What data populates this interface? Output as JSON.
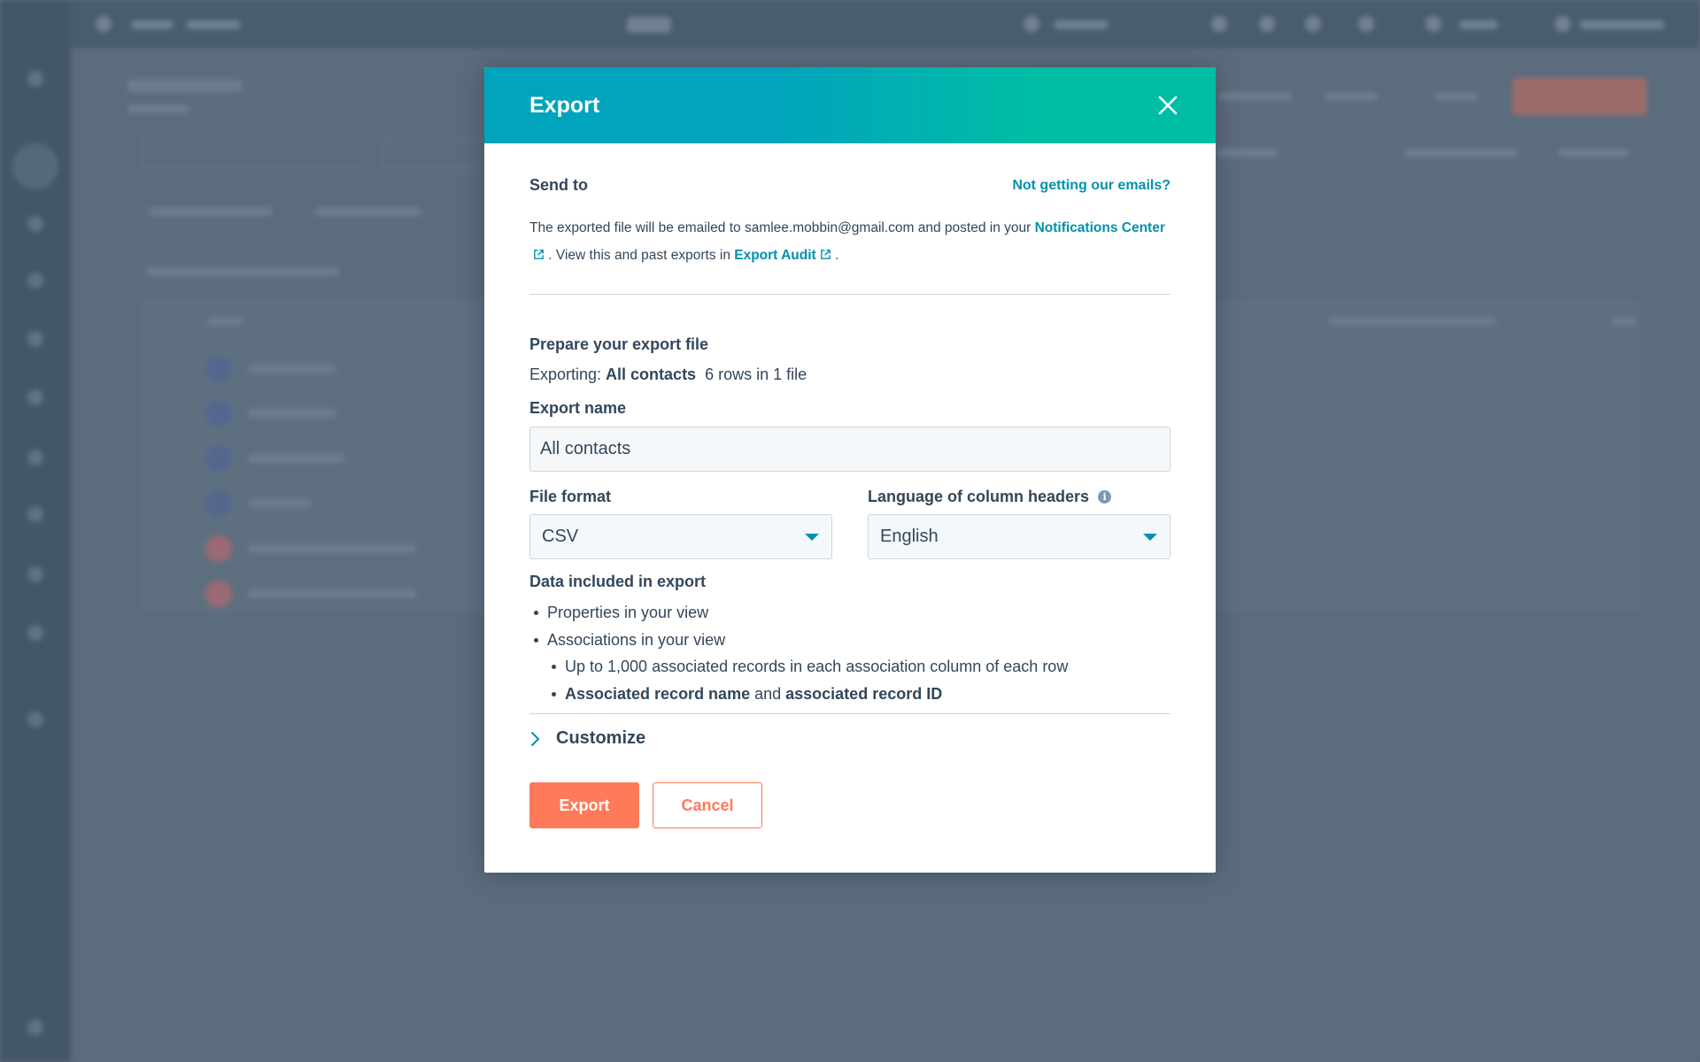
{
  "modal": {
    "title": "Export",
    "send_to": {
      "label": "Send to",
      "help_link": "Not getting our emails?",
      "desc_part1": "The exported file will be emailed to samlee.mobbin@gmail.com and posted in your ",
      "notifications_link": "Notifications Center",
      "desc_part2": " . View this and past exports in ",
      "audit_link": "Export Audit",
      "desc_part3": " ."
    },
    "prepare": {
      "title": "Prepare your export file",
      "exporting_label": "Exporting: ",
      "exporting_value": "All contacts",
      "exporting_count": "6 rows in 1 file"
    },
    "export_name": {
      "label": "Export name",
      "value": "All contacts"
    },
    "file_format": {
      "label": "File format",
      "selected": "CSV"
    },
    "language": {
      "label": "Language of column headers",
      "selected": "English"
    },
    "data_included": {
      "title": "Data included in export",
      "item1": "Properties in your view",
      "item2": "Associations in your view",
      "sub1": "Up to 1,000 associated records in each association column of each row",
      "sub2_bold1": "Associated record name",
      "sub2_mid": " and ",
      "sub2_bold2": "associated record ID"
    },
    "customize_label": "Customize",
    "buttons": {
      "export": "Export",
      "cancel": "Cancel"
    }
  },
  "colors": {
    "header_start": "#00a4bd",
    "header_end": "#00bda5",
    "link": "#0091ae",
    "primary": "#ff7a59",
    "text": "#33475b"
  }
}
